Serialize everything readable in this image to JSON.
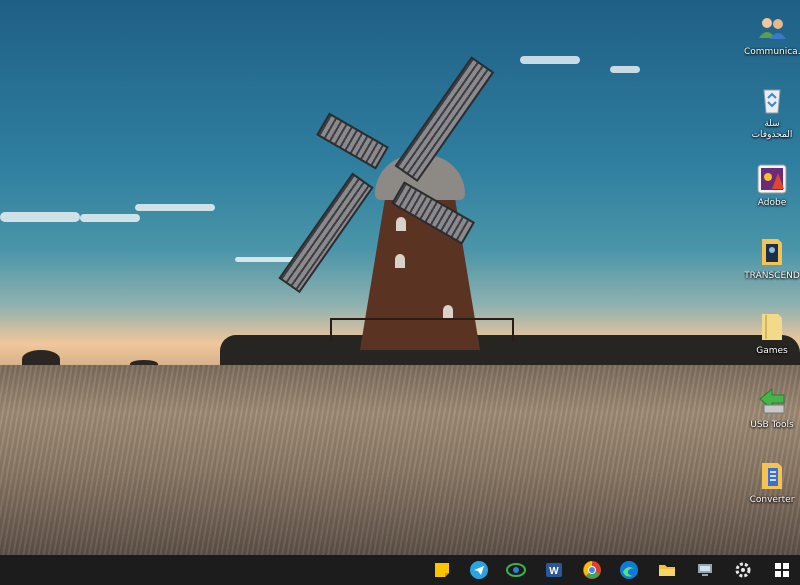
{
  "desktop": {
    "icons": [
      {
        "label": "Communica...",
        "icon": "people-icon"
      },
      {
        "label": "سلة المحذوفات",
        "icon": "recycle-bin-icon"
      },
      {
        "label": "Adobe",
        "icon": "adobe-app-icon"
      },
      {
        "label": "TRANSCEND",
        "icon": "folder-icon"
      },
      {
        "label": "Games",
        "icon": "folder-icon"
      },
      {
        "label": "USB Tools",
        "icon": "usb-arrow-icon"
      },
      {
        "label": "Converter",
        "icon": "folder-icon"
      }
    ]
  },
  "taskbar": {
    "items": [
      {
        "name": "sticky-notes-icon",
        "color": "#f7c600"
      },
      {
        "name": "telegram-icon",
        "color": "#2aa3e0"
      },
      {
        "name": "download-manager-icon",
        "color": "#3ab54a"
      },
      {
        "name": "word-icon",
        "color": "#2b579a"
      },
      {
        "name": "chrome-icon",
        "color": "#e0402a"
      },
      {
        "name": "edge-icon",
        "color": "#0f7bd8"
      },
      {
        "name": "file-explorer-icon",
        "color": "#f3c13a"
      },
      {
        "name": "network-icon",
        "color": "#9aa4ad"
      },
      {
        "name": "settings-gear-icon",
        "color": "#e8e8e8"
      },
      {
        "name": "windows-start-icon",
        "color": "#ffffff"
      }
    ]
  }
}
